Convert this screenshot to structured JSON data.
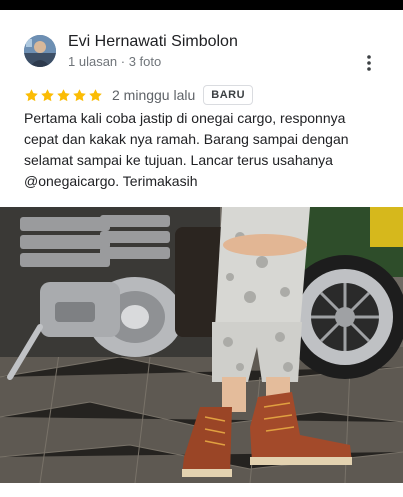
{
  "review": {
    "author_name": "Evi Hernawati Simbolon",
    "author_meta": "1 ulasan · 3 foto",
    "rating": 5,
    "rating_max": 5,
    "date": "2 minggu lalu",
    "badge": "BARU",
    "text": "Pertama kali coba jastip di onegai cargo, responnya cepat dan kakak nya ramah. Barang sampai dengan selamat sampai ke tujuan. Lancar terus usahanya @onegaicargo. Terimakasih"
  },
  "icons": {
    "menu": "more-vert-icon",
    "star": "star-icon"
  },
  "colors": {
    "star": "#fbbc04",
    "text": "#202124",
    "secondary_text": "#70757a"
  }
}
